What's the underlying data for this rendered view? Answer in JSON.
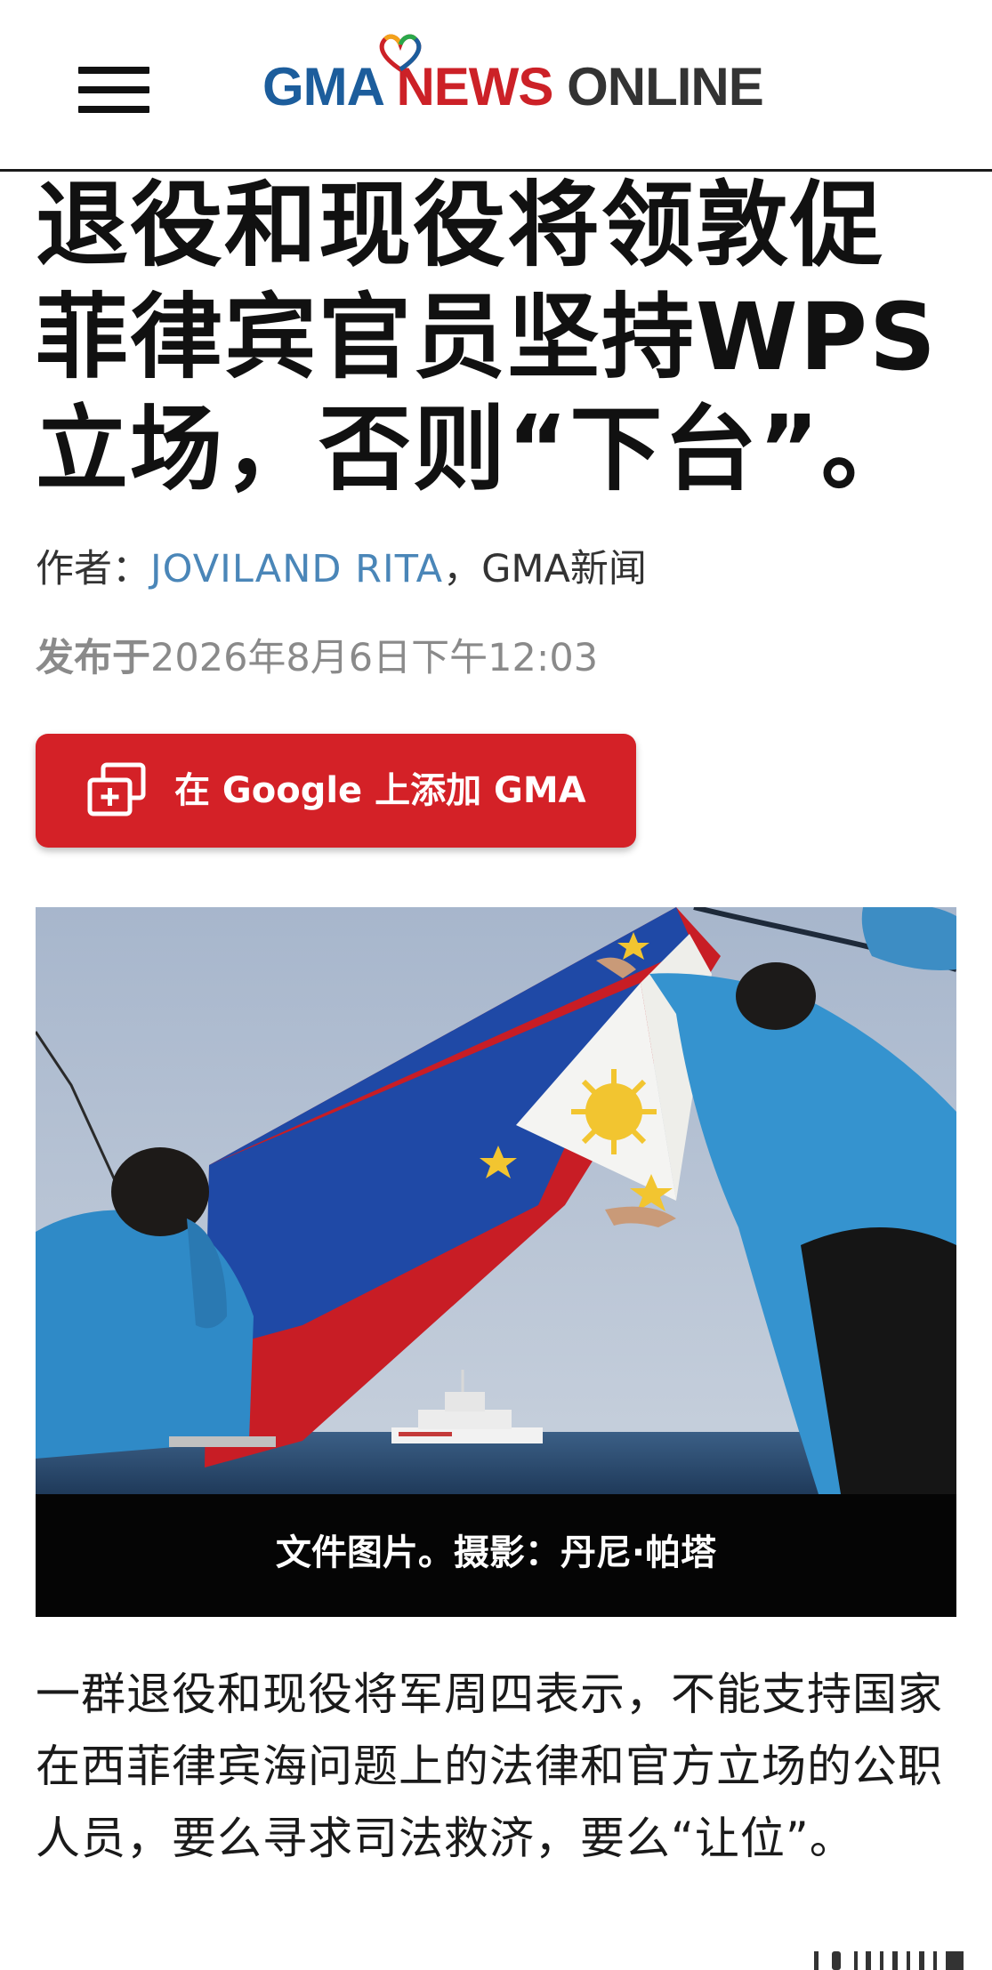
{
  "header": {
    "logo_gma": "GMA",
    "logo_news": "NEWS",
    "logo_online": "ONLINE",
    "menu_icon": "hamburger-menu-icon"
  },
  "article": {
    "headline": "退役和现役将领敦促菲律宾官员坚持WPS立场，否则“下台”。",
    "byline_prefix": "作者：",
    "author": "JOVILAND RITA",
    "byline_suffix": "，GMA新闻",
    "published_label": "发布于",
    "published_date": "2026年8月6日下午12:03",
    "google_button_label": "在 Google 上添加 GMA",
    "google_button_icon": "add-to-collection-icon",
    "photo_caption": "文件图片。摄影：丹尼·帕塔",
    "body_paragraph": "一群退役和现役将军周四表示，不能支持国家在西菲律宾海问题上的法律和官方立场的公职人员，要么寻求司法救济，要么“让位”。"
  },
  "colors": {
    "brand_blue": "#1c5d9c",
    "brand_red": "#cc2127",
    "button_red": "#d42127",
    "author_link": "#4a86b8",
    "date_gray": "#8a8a8a"
  }
}
